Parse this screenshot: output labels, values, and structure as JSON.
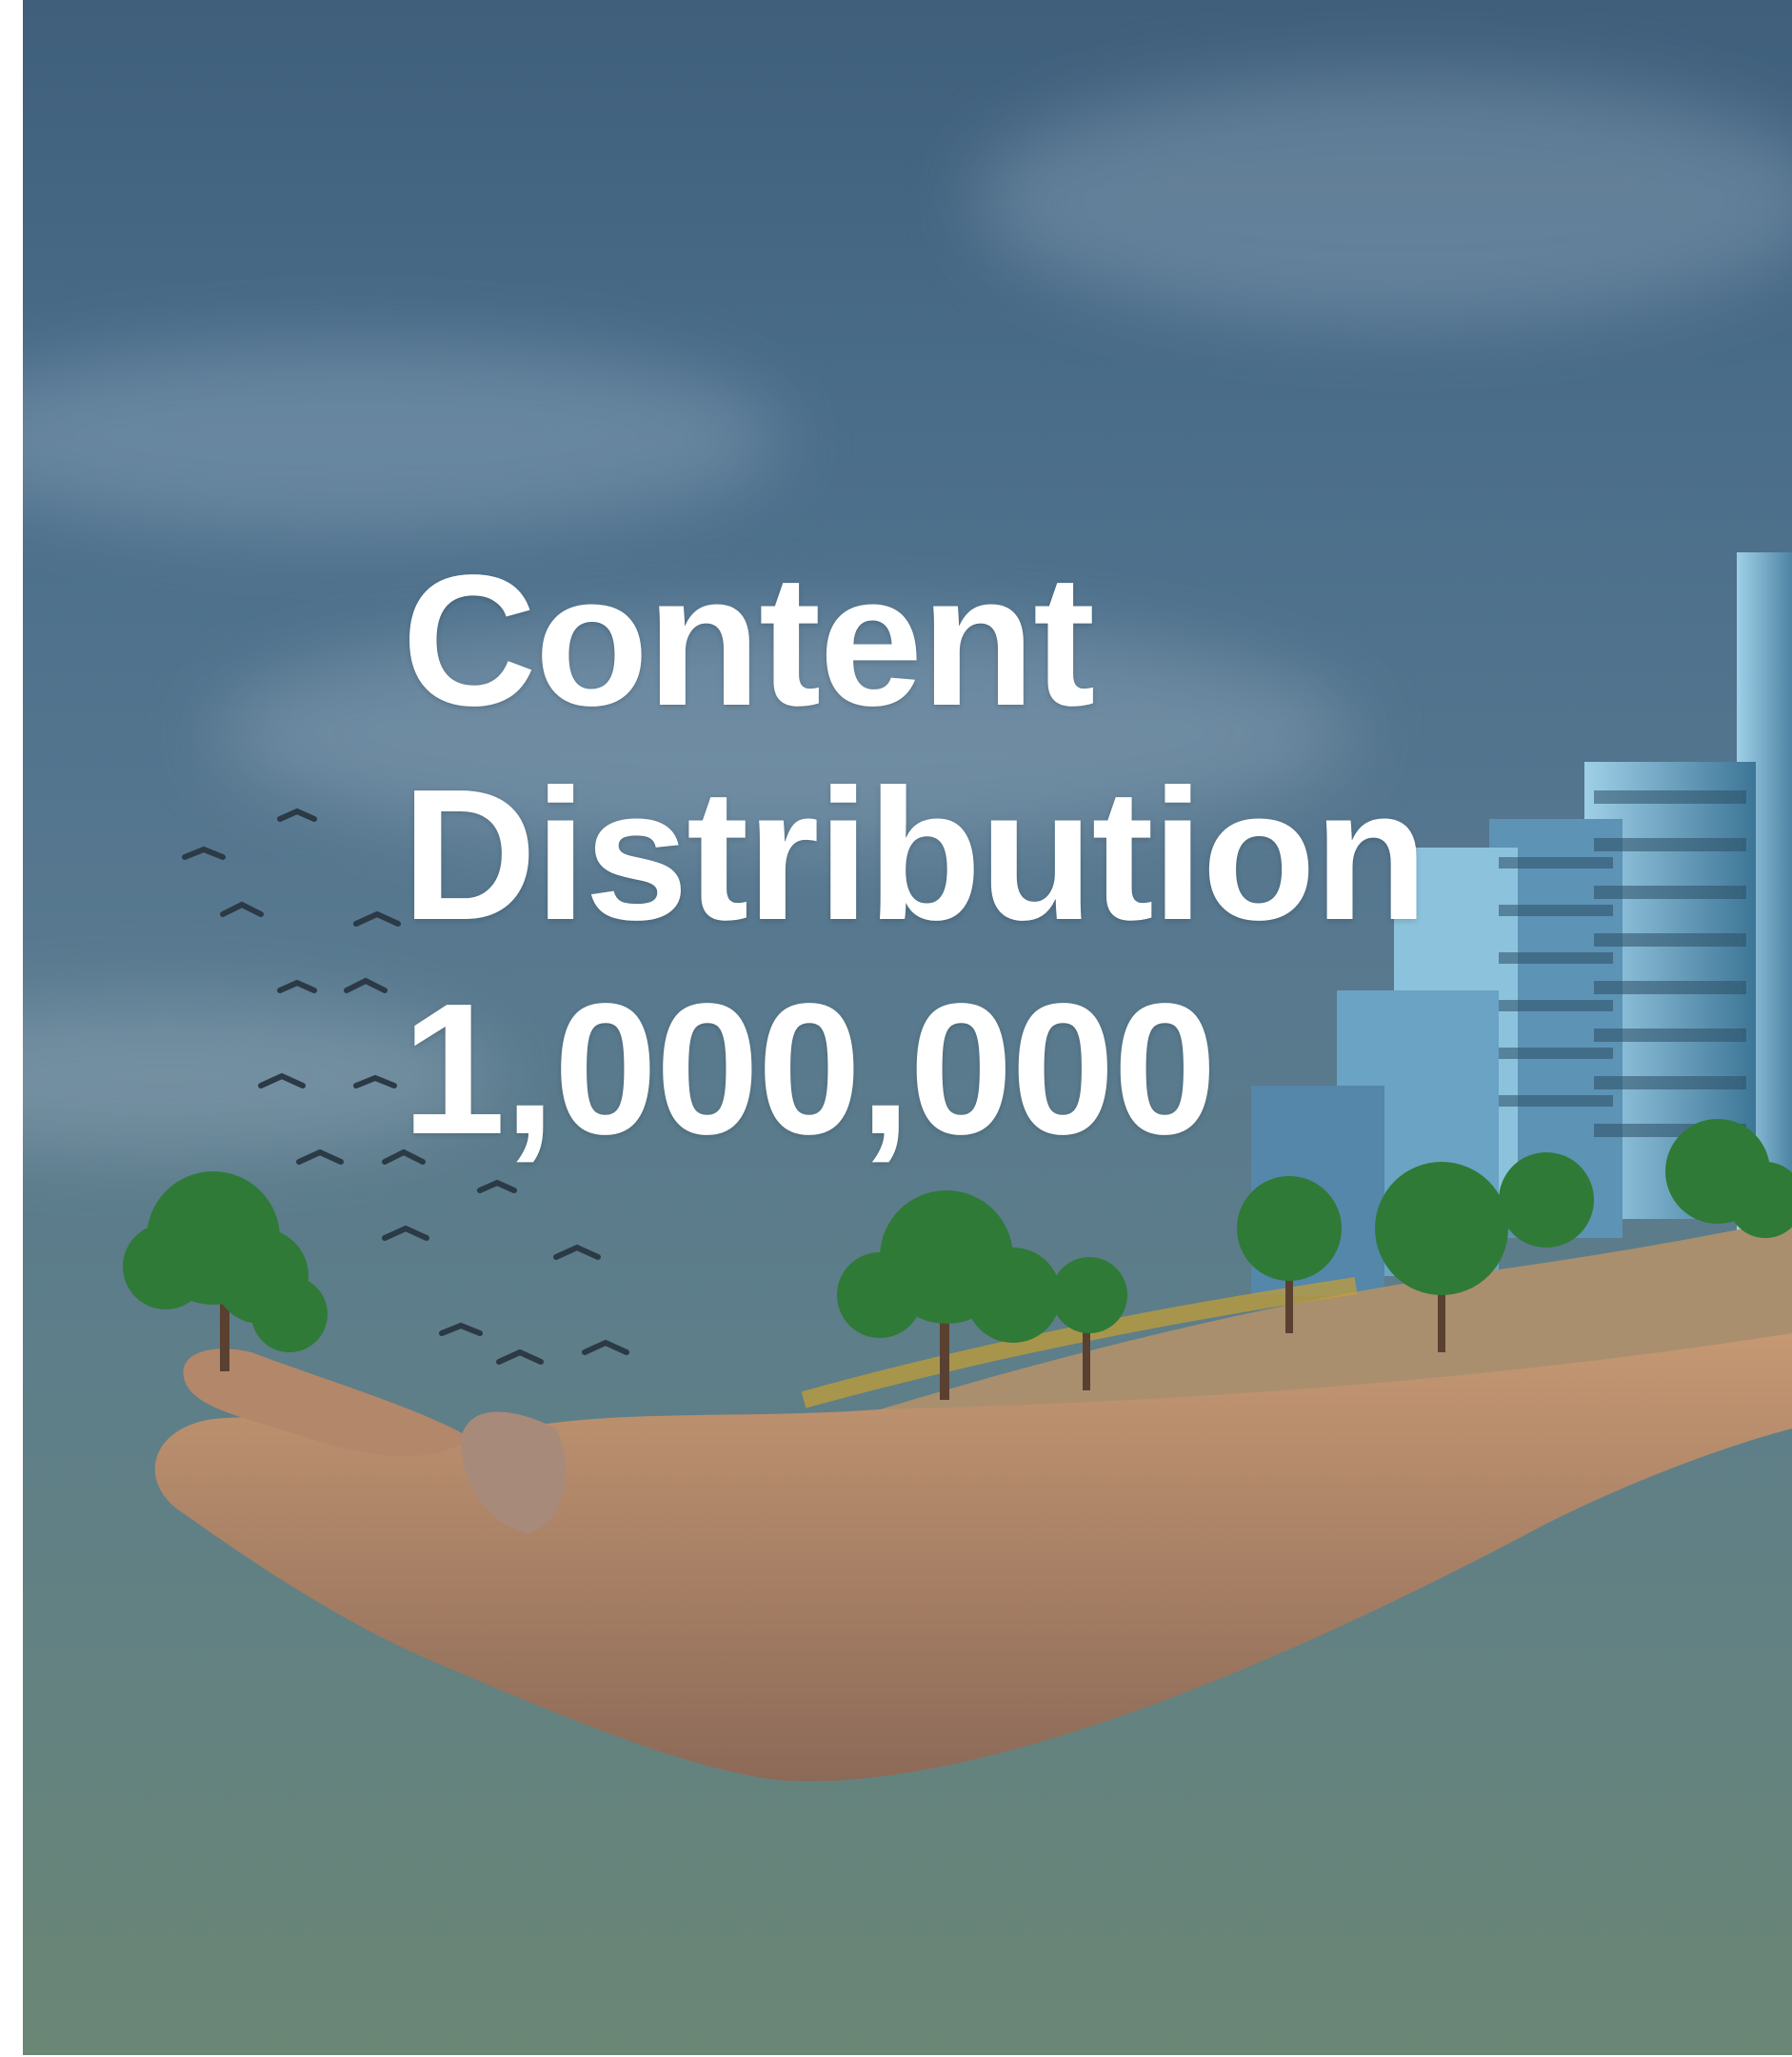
{
  "hero": {
    "line1": "Content",
    "line2": "Distribution",
    "figure": "1,000,000"
  },
  "illustration": {
    "subject": "hand-holding-city",
    "colors": {
      "sky_top": "#3f5f7b",
      "sky_bottom": "#6a8675",
      "skin": "#b98a67",
      "foliage": "#2f7a36",
      "building": "#6fa8c8"
    }
  }
}
